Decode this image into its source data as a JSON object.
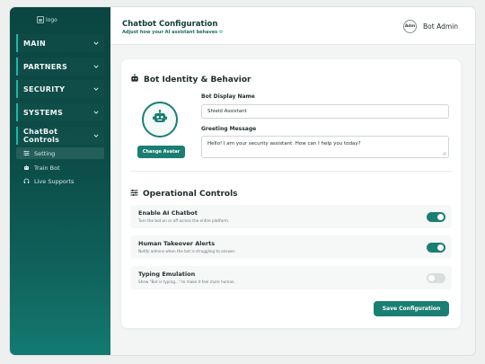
{
  "sidebar": {
    "logo_alt": "logo",
    "groups": [
      {
        "label": "MAIN"
      },
      {
        "label": "PARTNERS"
      },
      {
        "label": "SECURITY"
      },
      {
        "label": "SYSTEMS"
      },
      {
        "label": "ChatBot Controls"
      }
    ],
    "subitems": [
      {
        "label": "Setting",
        "icon": "sliders-icon",
        "active": true
      },
      {
        "label": "Train Bot",
        "icon": "robot-icon",
        "active": false
      },
      {
        "label": "Live Supports",
        "icon": "headset-icon",
        "active": false
      }
    ],
    "accent": "#21b8a4",
    "bg": "#0c4d48"
  },
  "header": {
    "title": "Chatbot Configuration",
    "subtitle": "Adjust how your AI assistant behaves",
    "user": {
      "avatar_text": "Adm",
      "name": "Bot Admin"
    }
  },
  "identity": {
    "title": "Bot Identity & Behavior",
    "change_avatar": "Change Avatar",
    "display_name_label": "Bot Display Name",
    "display_name_value": "Shield Assistant",
    "greeting_label": "Greeting Message",
    "greeting_value": "Hello! I am your security assistant. How can I help you today?"
  },
  "controls": {
    "title": "Operational Controls",
    "items": [
      {
        "title": "Enable AI Chatbot",
        "desc": "Turn the bot on or off across the entire platform.",
        "enabled": true
      },
      {
        "title": "Human Takeover Alerts",
        "desc": "Notify admins when the bot is struggling to answer.",
        "enabled": true
      },
      {
        "title": "Typing Emulation",
        "desc": "Show \"Bot is typing...\" to make it feel more human.",
        "enabled": false
      }
    ]
  },
  "save_label": "Save Configuration",
  "colors": {
    "primary": "#1b7e73",
    "toggle_off": "#d9dddd"
  }
}
